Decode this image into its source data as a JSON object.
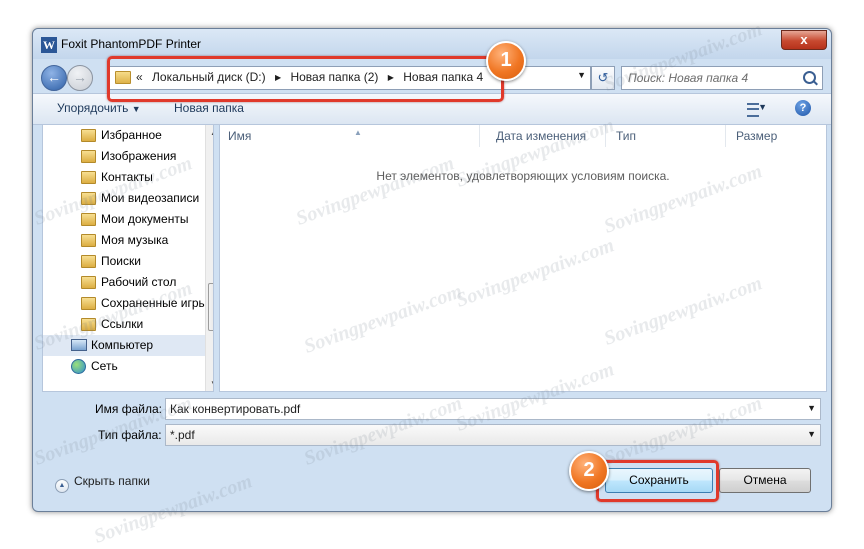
{
  "window": {
    "title": "Foxit PhantomPDF Printer",
    "app_icon_letter": "W",
    "close_glyph": "x"
  },
  "address_bar": {
    "overflow_glyph": "«",
    "crumbs": [
      "Локальный диск (D:)",
      "Новая папка (2)",
      "Новая папка 4"
    ],
    "separator_glyph": "▶"
  },
  "search": {
    "placeholder": "Поиск: Новая папка 4"
  },
  "toolbar": {
    "organize_label": "Упорядочить",
    "new_folder_label": "Новая папка",
    "help_glyph": "?"
  },
  "sidebar": {
    "items": [
      {
        "label": "Избранное",
        "icon": "folder-icon"
      },
      {
        "label": "Изображения",
        "icon": "folder-icon"
      },
      {
        "label": "Контакты",
        "icon": "folder-icon"
      },
      {
        "label": "Мои видеозаписи",
        "icon": "folder-icon"
      },
      {
        "label": "Мои документы",
        "icon": "folder-icon"
      },
      {
        "label": "Моя музыка",
        "icon": "folder-icon"
      },
      {
        "label": "Поиски",
        "icon": "folder-icon"
      },
      {
        "label": "Рабочий стол",
        "icon": "folder-icon"
      },
      {
        "label": "Сохраненные игры",
        "icon": "folder-icon"
      },
      {
        "label": "Ссылки",
        "icon": "folder-icon"
      },
      {
        "label": "Компьютер",
        "icon": "computer-icon"
      },
      {
        "label": "Сеть",
        "icon": "network-icon"
      }
    ]
  },
  "list": {
    "columns": [
      "Имя",
      "Дата изменения",
      "Тип",
      "Размер"
    ],
    "empty_message": "Нет элементов, удовлетворяющих условиям поиска."
  },
  "form": {
    "filename_label": "Имя файла:",
    "filename_value": "Как конвертировать.pdf",
    "filetype_label": "Тип файла:",
    "filetype_value": "*.pdf"
  },
  "footer": {
    "hide_folders_label": "Скрыть папки",
    "save_label": "Сохранить",
    "cancel_label": "Отмена"
  },
  "annotations": {
    "badge_1": "1",
    "badge_2": "2",
    "highlight_color": "#e0392b",
    "badge_color": "#f07623"
  },
  "watermark": {
    "text": "Sovingpewpaiw.com"
  }
}
